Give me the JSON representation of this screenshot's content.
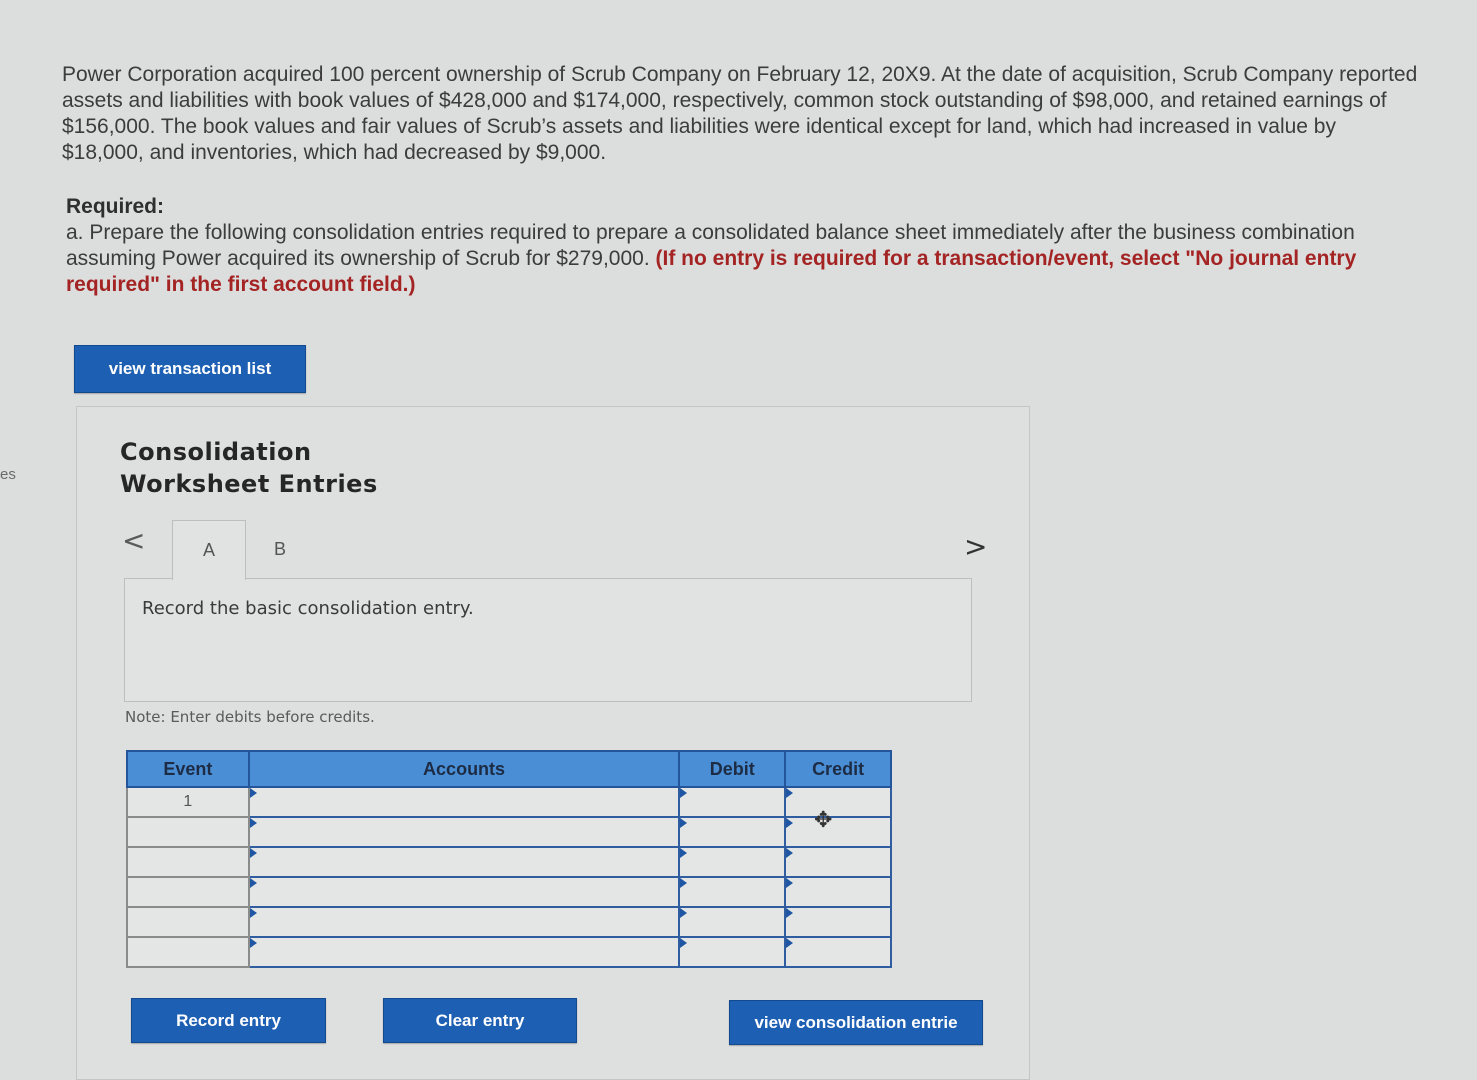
{
  "edge_label": "es",
  "problem": {
    "text": "Power Corporation acquired 100 percent ownership of Scrub Company on February 12, 20X9. At the date of acquisition, Scrub Company reported assets and liabilities with book values of $428,000 and $174,000, respectively, common stock outstanding of $98,000, and retained earnings of $156,000. The book values and fair values of Scrub’s assets and liabilities were identical except for land, which had increased in value by $18,000, and inventories, which had decreased by $9,000."
  },
  "required": {
    "heading": "Required:",
    "text": "a. Prepare the following consolidation entries required to prepare a consolidated balance sheet immediately after the business combination assuming Power acquired its ownership of Scrub for $279,000.",
    "note_red": "(If no entry is required for a transaction/event, select \"No journal entry required\" in the first account field.)"
  },
  "buttons": {
    "view_transaction_list": "view transaction list",
    "record_entry": "Record entry",
    "clear_entry": "Clear entry",
    "view_consolidation_entries": "view consolidation entrie"
  },
  "worksheet": {
    "title_line1": "Consolidation",
    "title_line2": "Worksheet Entries",
    "prev_arrow": "<",
    "next_arrow": ">",
    "tabs": [
      {
        "label": "A",
        "active": true
      },
      {
        "label": "B",
        "active": false
      }
    ],
    "instruction": "Record the basic consolidation entry.",
    "note": "Note: Enter debits before credits."
  },
  "journal": {
    "columns": [
      "Event",
      "Accounts",
      "Debit",
      "Credit"
    ],
    "rows": [
      {
        "event": "1",
        "account": "",
        "debit": "",
        "credit": ""
      },
      {
        "event": "",
        "account": "",
        "debit": "",
        "credit": ""
      },
      {
        "event": "",
        "account": "",
        "debit": "",
        "credit": ""
      },
      {
        "event": "",
        "account": "",
        "debit": "",
        "credit": ""
      },
      {
        "event": "",
        "account": "",
        "debit": "",
        "credit": ""
      },
      {
        "event": "",
        "account": "",
        "debit": "",
        "credit": ""
      }
    ]
  },
  "cursor": {
    "icon": "move-cursor-icon",
    "glyph": "✥"
  },
  "colors": {
    "page_background": "#dcdddd",
    "button_blue": "#1d5fb3",
    "table_header_blue": "#4a8fd6",
    "instruction_red": "#a42424"
  }
}
